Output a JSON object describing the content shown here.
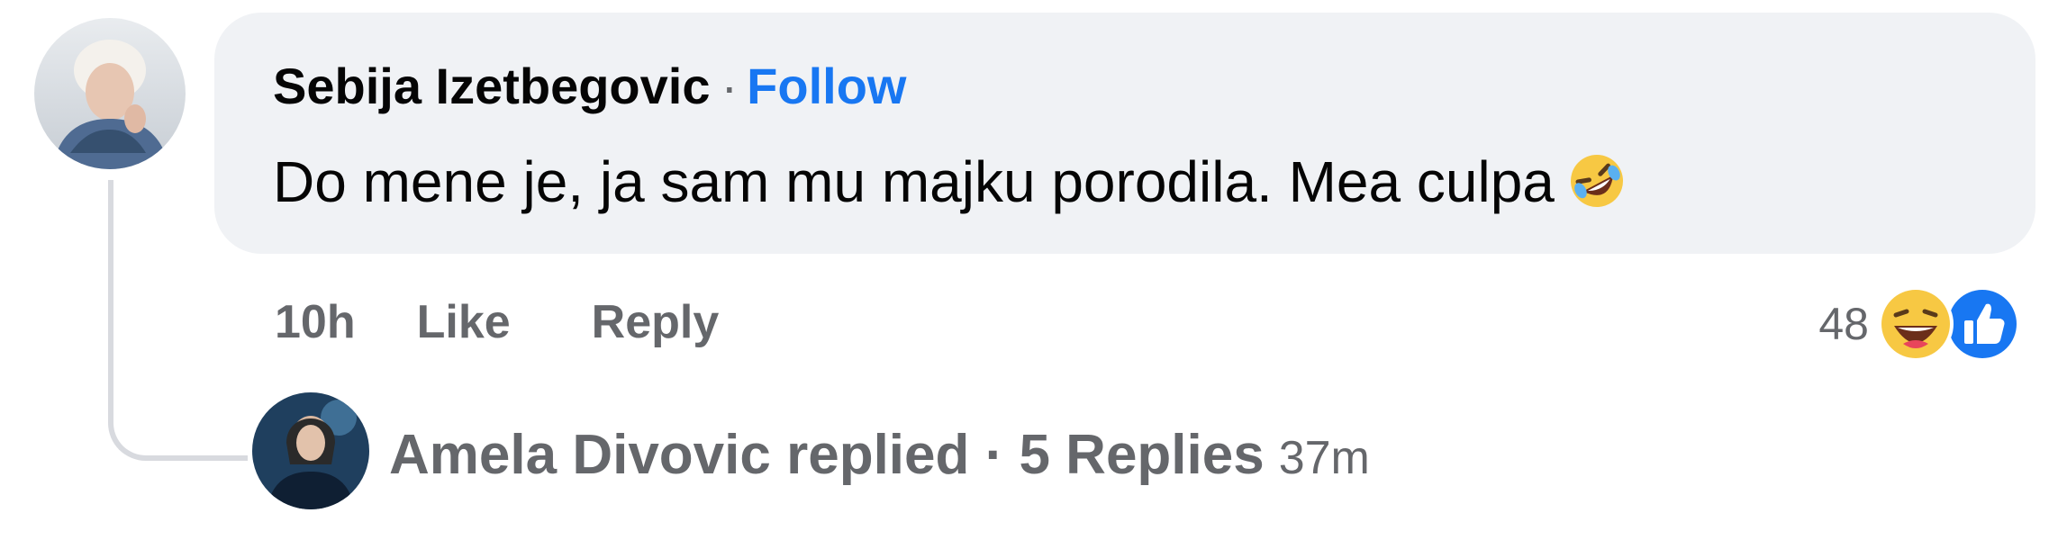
{
  "comment": {
    "author_name": "Sebija Izetbegovic",
    "separator": "·",
    "follow_label": "Follow",
    "text": "Do mene je, ja sam mu majku porodila. Mea culpa",
    "inline_emoji_icon": "rolling-on-floor-laughing-icon",
    "timestamp": "10h",
    "like_label": "Like",
    "reply_label": "Reply",
    "reaction_count": "48",
    "reaction_icons": [
      "haha-reaction-icon",
      "like-reaction-icon"
    ]
  },
  "replies_summary": {
    "text": "Amela Divovic replied · 5 Replies",
    "time": "37m"
  },
  "colors": {
    "bubble": "#f0f2f5",
    "follow_link": "#1877f2",
    "meta_text": "#65676b",
    "body_text": "#050505",
    "like_blue": "#1877f2",
    "haha_yellow": "#f7c843"
  }
}
